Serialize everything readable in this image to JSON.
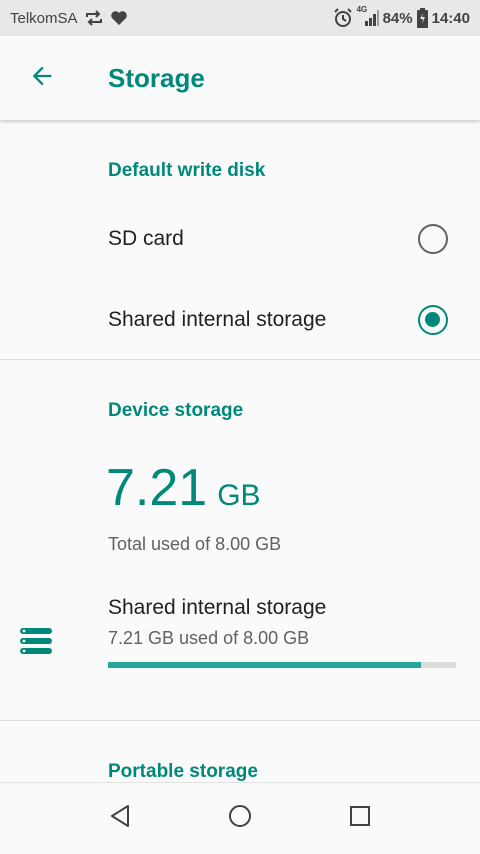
{
  "status_bar": {
    "carrier": "TelkomSA",
    "network": "4G",
    "battery": "84%",
    "time": "14:40"
  },
  "app_bar": {
    "title": "Storage"
  },
  "default_write_disk": {
    "header": "Default write disk",
    "options": [
      {
        "label": "SD card",
        "selected": false
      },
      {
        "label": "Shared internal storage",
        "selected": true
      }
    ]
  },
  "device_storage": {
    "header": "Device storage",
    "used_value": "7.21",
    "used_unit": "GB",
    "total_text": "Total used of 8.00 GB",
    "volume": {
      "title": "Shared internal storage",
      "summary": "7.21 GB used of 8.00 GB",
      "used_fraction": 0.9
    }
  },
  "portable_storage": {
    "header": "Portable storage"
  },
  "colors": {
    "accent": "#00897b",
    "progress": "#26a69a"
  }
}
